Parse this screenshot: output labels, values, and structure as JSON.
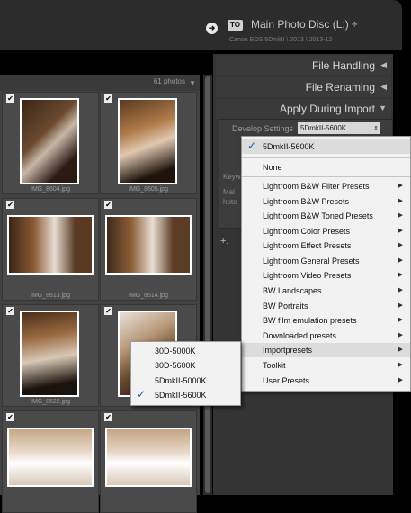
{
  "header": {
    "to_badge": "TO",
    "disc_title": "Main Photo Disc (L:) ÷",
    "disc_subtitle": "Canon EOS 5DmkII \\ 2013 \\ 2013-12"
  },
  "grid": {
    "photo_count": "61 photos",
    "cells": [
      {
        "filename": "IMG_8604.jpg",
        "checked": true
      },
      {
        "filename": "IMG_8605.jpg",
        "checked": true
      },
      {
        "filename": "IMG_8613.jpg",
        "checked": true
      },
      {
        "filename": "IMG_8614.jpg",
        "checked": true
      },
      {
        "filename": "IMG_8622.jpg",
        "checked": true
      },
      {
        "filename": "",
        "checked": true
      },
      {
        "filename": "",
        "checked": true
      },
      {
        "filename": "",
        "checked": true
      }
    ]
  },
  "right_panel": {
    "sections": [
      "File Handling",
      "File Renaming",
      "Apply During Import"
    ],
    "develop_settings_label": "Develop Settings",
    "develop_settings_value": "5DmkII-5600K",
    "keywords_label": "Keyw",
    "metadata_label": "Mal hote"
  },
  "menu": {
    "selected": "5DmkII-5600K",
    "none": "None",
    "items": [
      "Lightroom B&W Filter Presets",
      "Lightroom B&W Presets",
      "Lightroom B&W Toned Presets",
      "Lightroom Color Presets",
      "Lightroom Effect Presets",
      "Lightroom General Presets",
      "Lightroom Video Presets",
      "BW Landscapes",
      "BW Portraits",
      "BW film emulation presets",
      "Downloaded presets",
      "Importpresets",
      "Toolkit",
      "User Presets"
    ]
  },
  "submenu": {
    "items": [
      "30D-5000K",
      "30D-5600K",
      "5DmkII-5000K",
      "5DmkII-5600K"
    ],
    "checked_index": 3
  },
  "colors": {
    "accent_check": "#1a5fc0",
    "panel_bg": "#343434",
    "grid_bg": "#424242"
  }
}
